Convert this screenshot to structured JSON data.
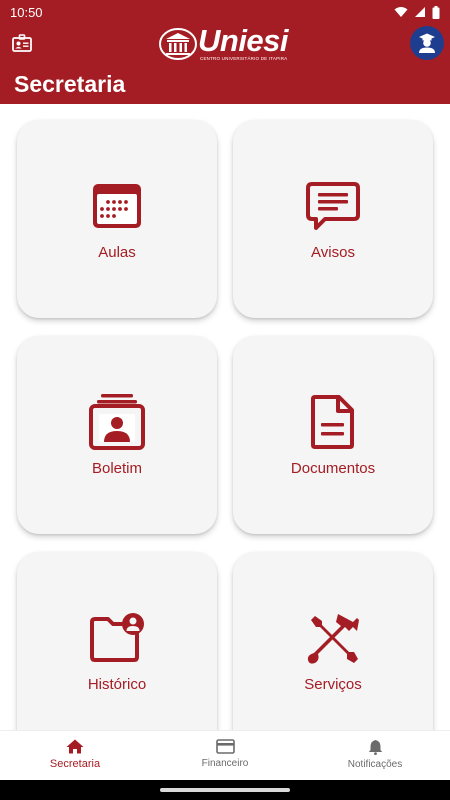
{
  "status_bar": {
    "time": "10:50"
  },
  "header": {
    "logo_text": "Uniesi",
    "logo_subtitle": "CENTRO UNIVERSITÁRIO DE ITAPIRA",
    "page_title": "Secretaria"
  },
  "menu": {
    "items": [
      {
        "label": "Aulas",
        "icon": "calendar-icon"
      },
      {
        "label": "Avisos",
        "icon": "message-icon"
      },
      {
        "label": "Boletim",
        "icon": "report-card-icon"
      },
      {
        "label": "Documentos",
        "icon": "document-icon"
      },
      {
        "label": "Histórico",
        "icon": "folder-user-icon"
      },
      {
        "label": "Serviços",
        "icon": "tools-icon"
      }
    ]
  },
  "bottom_nav": {
    "items": [
      {
        "label": "Secretaria",
        "icon": "home-icon",
        "active": true
      },
      {
        "label": "Financeiro",
        "icon": "credit-card-icon",
        "active": false
      },
      {
        "label": "Notificações",
        "icon": "bell-icon",
        "active": false
      }
    ]
  },
  "colors": {
    "brand": "#a51d24",
    "card_bg": "#f5f5f5",
    "avatar_bg": "#1f3d8f"
  }
}
